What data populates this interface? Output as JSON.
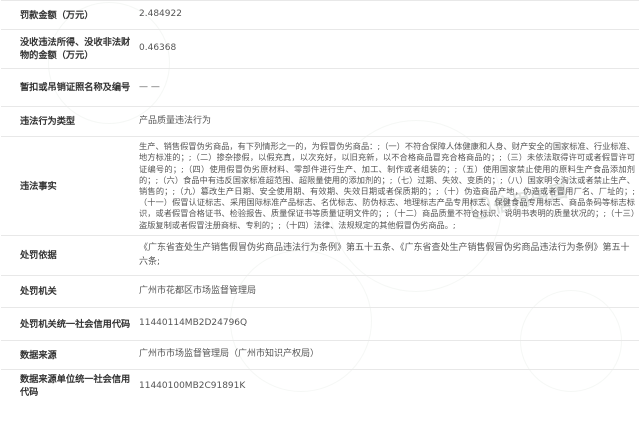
{
  "rows": [
    {
      "label": "罚款金额（万元）",
      "value": "2.484922"
    },
    {
      "label": "没收违法所得、没收非法财物的金额（万元）",
      "value": "0.46368"
    },
    {
      "label": "暂扣或吊销证照名称及编号",
      "value": "— —"
    },
    {
      "label": "违法行为类型",
      "value": "产品质量违法行为"
    },
    {
      "label": "违法事实",
      "value": "生产、销售假冒伪劣商品，有下列情形之一的，为假冒伪劣商品：;（一）不符合保障人体健康和人身、财产安全的国家标准、行业标准、地方标准的；;（二）掺杂掺假，以假充真，以次充好，以旧充新，以不合格商品冒充合格商品的；;（三）未依法取得许可或者假冒许可证编号的；;（四）使用假冒伪劣原材料、零部件进行生产、加工、制作或者组装的；;（五）使用国家禁止使用的原料生产食品添加剂的；;（六）食品中有违反国家标准超范围、超限量使用的添加剂的；;（七）过期、失效、变质的；;（八）国家明令淘汰或者禁止生产、销售的；;（九）篡改生产日期、安全使用期、有效期、失效日期或者保质期的；;（十）伪造商品产地，伪造或者冒用厂名、厂址的；;（十一）假冒认证标志、采用国际标准产品标志、名优标志、防伪标志、地理标志产品专用标志、保健食品专用标志、商品条码等标志标识，或者假冒合格证书、检验报告、质量保证书等质量证明文件的；;（十二）商品质量不符合标识、说明书表明的质量状况的；;（十三）盗版复制或者假冒注册商标、专利的；;（十四）法律、法规规定的其他假冒伪劣商品。;"
    },
    {
      "label": "处罚依据",
      "value": "《广东省查处生产销售假冒伪劣商品违法行为条例》第五十五条、《广东省查处生产销售假冒伪劣商品违法行为条例》第五十六条;"
    },
    {
      "label": "处罚机关",
      "value": "广州市花都区市场监督管理局"
    },
    {
      "label": "处罚机关统一社会信用代码",
      "value": "11440114MB2D24796Q"
    },
    {
      "label": "数据来源",
      "value": "广州市市场监督管理局（广州市知识产权局）"
    },
    {
      "label": "数据来源单位统一社会信用代码",
      "value": "11440100MB2C91891K"
    }
  ],
  "watermark": "信用中国",
  "colors": {
    "label": "#333333",
    "value": "#555555",
    "border": "#e8e8e8"
  }
}
